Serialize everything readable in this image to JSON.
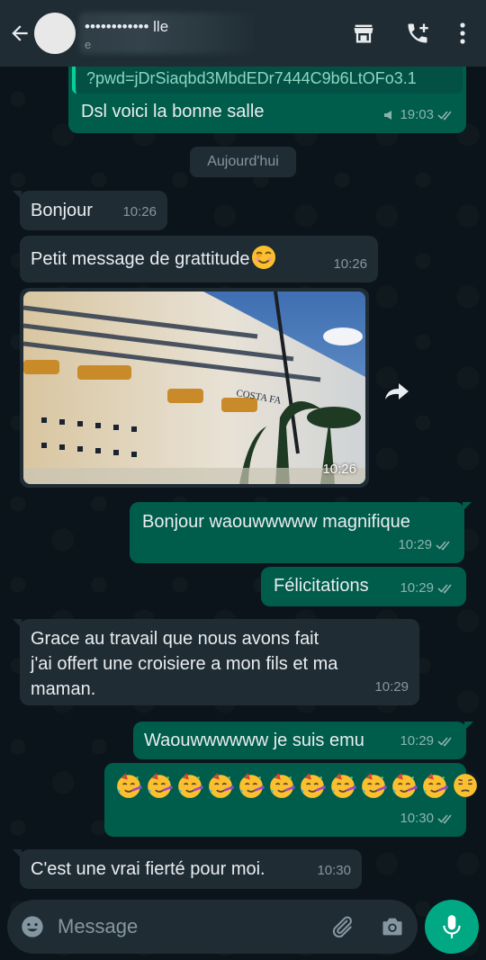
{
  "header": {
    "contact_name": "•••••••••••• lle",
    "contact_sub": "e"
  },
  "messages": {
    "m0": {
      "link": "?pwd=jDrSiaqbd3MbdEDr7444C9b6LtOFo3.1",
      "text": "Dsl voici la bonne salle",
      "time": "19:03"
    },
    "date_chip": "Aujourd'hui",
    "m1": {
      "text": "Bonjour",
      "time": "10:26"
    },
    "m2": {
      "text": "Petit message de grattitude",
      "time": "10:26"
    },
    "m3": {
      "image_label": "COSTA FA",
      "time": "10:26"
    },
    "m4": {
      "text": "Bonjour waouwwwww magnifique",
      "time": "10:29"
    },
    "m5": {
      "text": "Félicitations",
      "time": "10:29"
    },
    "m6": {
      "line1": "Grace au travail que nous avons fait",
      "line2": "j'ai offert une croisiere a mon fils et ma",
      "line3": "maman.",
      "time": "10:29"
    },
    "m7": {
      "text": "Waouwwwwww je suis emu",
      "time": "10:29"
    },
    "m8": {
      "time": "10:30",
      "party_count": 11,
      "last_emoji": "pensive-face"
    },
    "m9": {
      "text": "C'est une vrai fierté pour moi.",
      "time": "10:30"
    }
  },
  "input": {
    "placeholder": "Message"
  },
  "colors": {
    "background": "#0b141a",
    "header": "#1f2c34",
    "incoming": "#1f2c34",
    "outgoing": "#005c4b",
    "accent": "#00a884",
    "read_tick": "#53bdeb"
  }
}
